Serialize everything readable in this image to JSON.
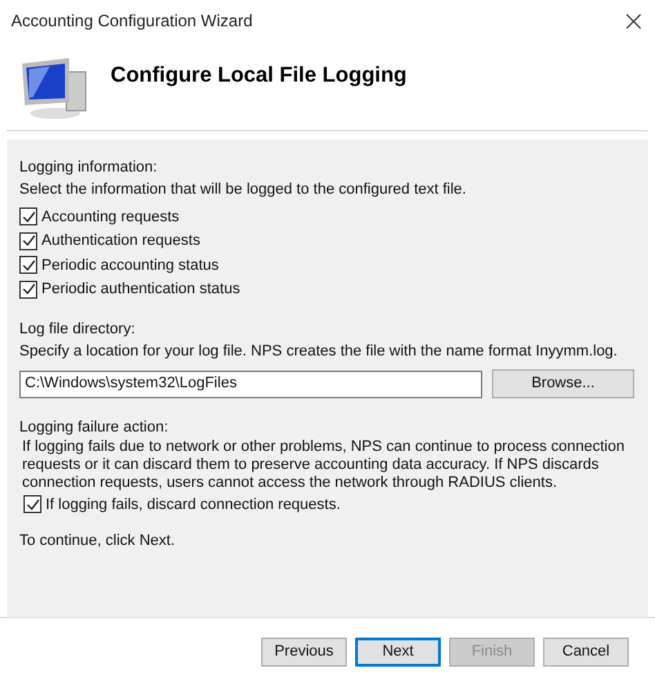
{
  "window": {
    "title": "Accounting Configuration Wizard"
  },
  "header": {
    "title": "Configure Local File Logging"
  },
  "logging_information": {
    "heading": "Logging information:",
    "description": "Select the information that will be logged to the configured text file.",
    "options": [
      {
        "label": "Accounting requests",
        "checked": true
      },
      {
        "label": "Authentication requests",
        "checked": true
      },
      {
        "label": "Periodic accounting status",
        "checked": true
      },
      {
        "label": "Periodic authentication status",
        "checked": true
      }
    ]
  },
  "log_file_directory": {
    "heading": "Log file directory:",
    "description": "Specify a location for your log file. NPS creates the file with the name format Inyymm.log.",
    "value": "C:\\Windows\\system32\\LogFiles",
    "browse_button": "Browse..."
  },
  "logging_failure_action": {
    "heading": "Logging failure action:",
    "description": "If logging fails due to network or other problems, NPS can  continue to process connection requests or it can discard them to preserve accounting data accuracy. If NPS discards connection requests, users cannot access the network through RADIUS clients.",
    "option": {
      "label": "If logging fails, discard connection requests.",
      "checked": true
    }
  },
  "footer_text": "To continue, click Next.",
  "buttons": [
    {
      "label": "Previous",
      "disabled": false,
      "selected": false
    },
    {
      "label": "Next",
      "disabled": false,
      "selected": true
    },
    {
      "label": "Finish",
      "disabled": true,
      "selected": false
    },
    {
      "label": "Cancel",
      "disabled": false,
      "selected": false
    }
  ]
}
